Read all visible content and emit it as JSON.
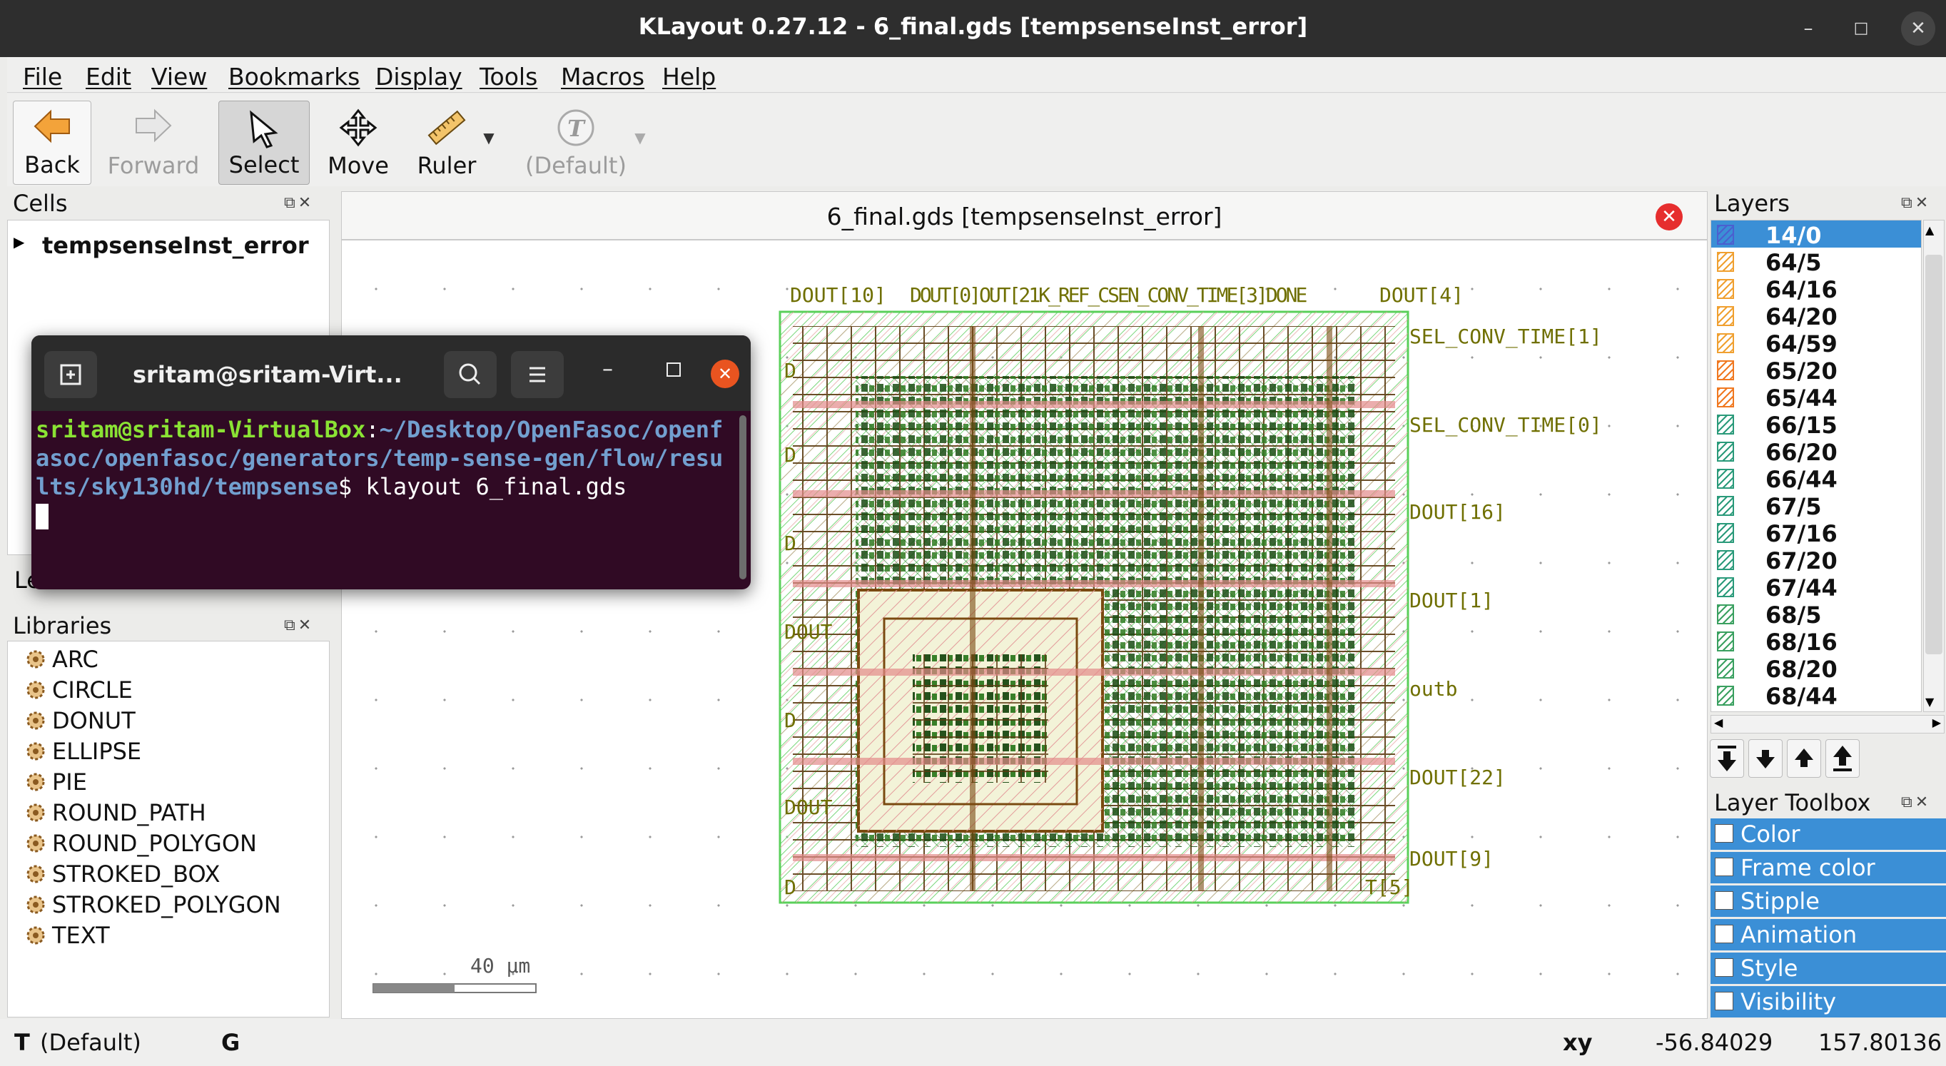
{
  "window": {
    "title": "KLayout 0.27.12 - 6_final.gds [tempsenseInst_error]",
    "minimize_label": "–",
    "maximize_label": "□",
    "close_label": "✕"
  },
  "menu": [
    "File",
    "Edit",
    "View",
    "Bookmarks",
    "Display",
    "Tools",
    "Macros",
    "Help"
  ],
  "toolbar": {
    "back": "Back",
    "forward": "Forward",
    "select": "Select",
    "move": "Move",
    "ruler": "Ruler",
    "default": "(Default)"
  },
  "cells": {
    "header": "Cells",
    "top_cell": "tempsenseInst_error"
  },
  "libraries": {
    "header": "Libraries",
    "items": [
      "ARC",
      "CIRCLE",
      "DONUT",
      "ELLIPSE",
      "PIE",
      "ROUND_PATH",
      "ROUND_POLYGON",
      "STROKED_BOX",
      "STROKED_POLYGON",
      "TEXT"
    ]
  },
  "hidden_panel_label": "Le",
  "view": {
    "tab_title": "6_final.gds [tempsenseInst_error]",
    "scale_label": "40  µm"
  },
  "pins": {
    "top_left": "DOUT[10]",
    "top_mid": "DOUT[0]OUT[21K_REF_CSEN_CONV_TIME[3]DONE",
    "top_right": "DOUT[4]",
    "sel1": "SEL_CONV_TIME[1]",
    "sel0": "SEL_CONV_TIME[0]",
    "dout16": "DOUT[16]",
    "dout1": "DOUT[1]",
    "outb": "outb",
    "dout22": "DOUT[22]",
    "dout9": "DOUT[9]",
    "bottom": "D",
    "bottom_right": "T[5]",
    "left1": "D",
    "left2": "D",
    "left3": "D",
    "left4": "D",
    "left5": "DOUT",
    "left6": "D",
    "left7": "DOUT"
  },
  "terminal": {
    "title": "sritam@sritam-Virt...",
    "user": "sritam@sritam-VirtualBox",
    "colon": ":",
    "path": "~/Desktop/OpenFasoc/openfasoc/openfasoc/generators/temp-sense-gen/flow/results/sky130hd/tempsense",
    "command": "$ klayout 6_final.gds"
  },
  "layers": {
    "header": "Layers",
    "items": [
      {
        "name": "14/0",
        "color": "#4b5fcf"
      },
      {
        "name": "64/5",
        "color": "#f0a030"
      },
      {
        "name": "64/16",
        "color": "#f0a030"
      },
      {
        "name": "64/20",
        "color": "#f0a030"
      },
      {
        "name": "64/59",
        "color": "#f0a030"
      },
      {
        "name": "65/20",
        "color": "#f07820"
      },
      {
        "name": "65/44",
        "color": "#f07820"
      },
      {
        "name": "66/15",
        "color": "#2a9a7a"
      },
      {
        "name": "66/20",
        "color": "#2a9a7a"
      },
      {
        "name": "66/44",
        "color": "#2a9a7a"
      },
      {
        "name": "67/5",
        "color": "#2a9a7a"
      },
      {
        "name": "67/16",
        "color": "#2a9a7a"
      },
      {
        "name": "67/20",
        "color": "#2a9a7a"
      },
      {
        "name": "67/44",
        "color": "#2a9a7a"
      },
      {
        "name": "68/5",
        "color": "#3aa060"
      },
      {
        "name": "68/16",
        "color": "#3aa060"
      },
      {
        "name": "68/20",
        "color": "#3aa060"
      },
      {
        "name": "68/44",
        "color": "#3aa060"
      }
    ]
  },
  "toolbox": {
    "header": "Layer Toolbox",
    "items": [
      "Color",
      "Frame color",
      "Stipple",
      "Animation",
      "Style",
      "Visibility"
    ]
  },
  "status": {
    "mode_t": "T",
    "mode_default": "(Default)",
    "mode_g": "G",
    "xy_label": "xy",
    "x": "-56.84029",
    "y": "157.80136"
  }
}
